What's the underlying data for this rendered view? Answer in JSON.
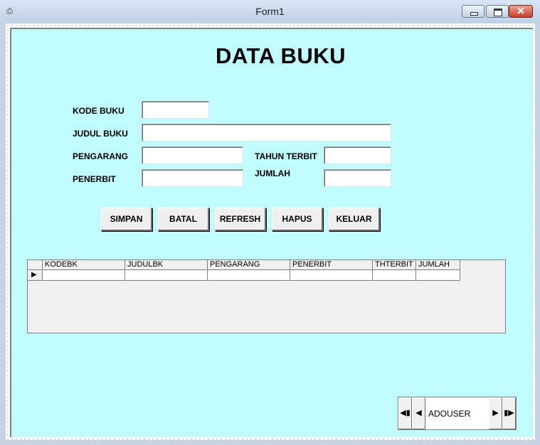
{
  "window": {
    "title": "Form1"
  },
  "form": {
    "heading": "DATA BUKU",
    "labels": {
      "kode": "KODE BUKU",
      "judul": "JUDUL BUKU",
      "pengarang": "PENGARANG",
      "penerbit": "PENERBIT",
      "tahun": "TAHUN TERBIT",
      "jumlah": "JUMLAH"
    },
    "fields": {
      "kode": "",
      "judul": "",
      "pengarang": "",
      "penerbit": "",
      "tahun": "",
      "jumlah": ""
    }
  },
  "buttons": {
    "simpan": "SIMPAN",
    "batal": "BATAL",
    "refresh": "REFRESH",
    "hapus": "HAPUS",
    "keluar": "KELUAR"
  },
  "grid": {
    "columns": [
      "KODEBK",
      "JUDULBK",
      "PENGARANG",
      "PENERBIT",
      "THTERBIT",
      "JUMLAH"
    ]
  },
  "adodc": {
    "caption": "ADOUSER"
  },
  "colors": {
    "form_bg": "#c0fcfc",
    "grid_bg": "#f0f0f0",
    "close_red": "#c7402a"
  }
}
